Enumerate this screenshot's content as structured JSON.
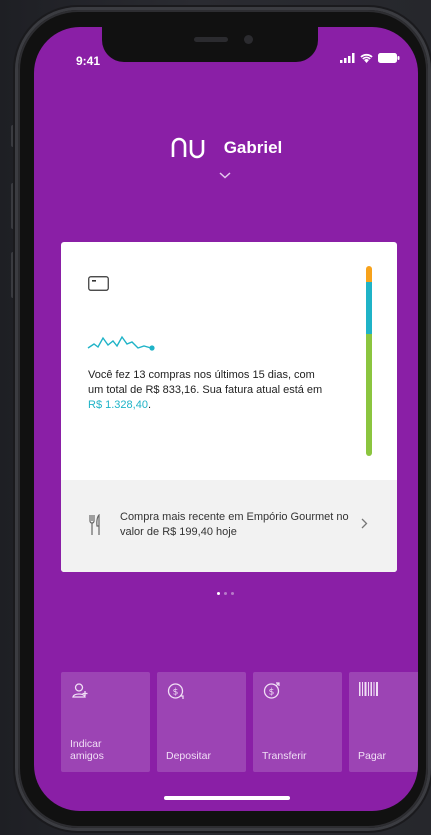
{
  "status_bar": {
    "time": "9:41"
  },
  "header": {
    "brand": "nu",
    "user_name": "Gabriel"
  },
  "card": {
    "summary_part1": "Você fez 13 compras nos últimos 15 dias, com um total de R$ 833,16. Sua fatura atual está em ",
    "summary_amount": "R$ 1.328,40",
    "summary_part2": ".",
    "recent_purchase": "Compra mais recente em Empório Gourmet no valor de R$ 199,40 hoje",
    "limit_bar_colors": [
      "#f7a21b",
      "#1fb3c7",
      "#8bc53f"
    ]
  },
  "carousel": {
    "pages": 3,
    "active": 0
  },
  "actions": [
    {
      "label": "Indicar\namigos",
      "icon": "person-add-icon"
    },
    {
      "label": "Depositar",
      "icon": "deposit-icon"
    },
    {
      "label": "Transferir",
      "icon": "transfer-icon"
    },
    {
      "label": "Pagar",
      "icon": "barcode-icon"
    }
  ],
  "colors": {
    "brand_purple": "#8a1fa6",
    "tile_purple": "#9c44b4",
    "accent_cyan": "#1fb3c7"
  }
}
